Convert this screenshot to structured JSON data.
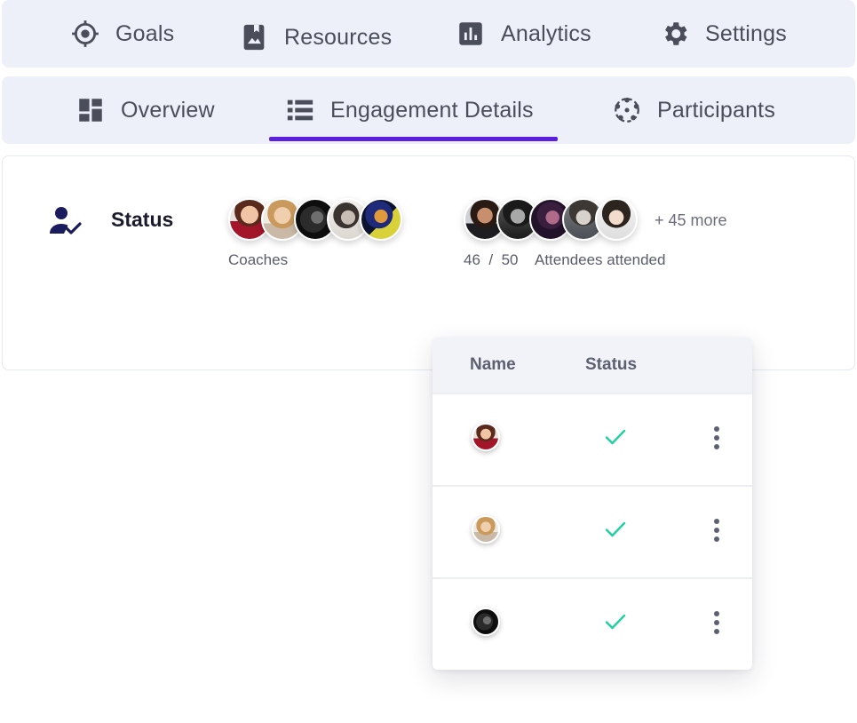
{
  "top_nav": [
    {
      "label": "Goals",
      "icon": "target-icon"
    },
    {
      "label": "Resources",
      "icon": "bookmark-image-icon"
    },
    {
      "label": "Analytics",
      "icon": "bar-chart-icon"
    },
    {
      "label": "Settings",
      "icon": "gear-icon"
    }
  ],
  "sub_tabs": [
    {
      "label": "Overview",
      "icon": "dashboard-icon"
    },
    {
      "label": "Engagement Details",
      "icon": "list-icon",
      "active": true
    },
    {
      "label": "Participants",
      "icon": "group-circle-icon"
    }
  ],
  "status": {
    "label": "Status",
    "coaches_label": "Coaches",
    "more_label": "+ 45 more",
    "attended": "46",
    "separator": "/",
    "total": "50",
    "attended_label": "Attendees attended"
  },
  "table": {
    "headers": {
      "name": "Name",
      "status": "Status"
    },
    "rows": [
      {
        "status": "attended"
      },
      {
        "status": "attended"
      },
      {
        "status": "attended"
      }
    ]
  },
  "colors": {
    "accent": "#5b1fe0",
    "check": "#1fd1a1",
    "nav_bg": "#eef0f9",
    "heading": "#1a1c2e"
  }
}
